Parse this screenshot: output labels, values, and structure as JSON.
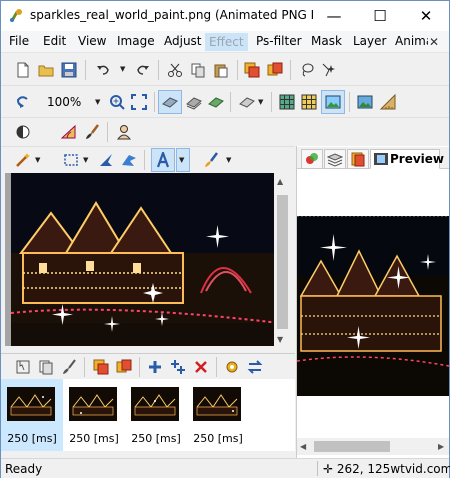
{
  "window": {
    "title": "sparkles_real_world_paint.png (Animated PNG Image, ...",
    "minimize_glyph": "—",
    "maximize_glyph": "☐",
    "close_glyph": "✕"
  },
  "menu": {
    "items": [
      "File",
      "Edit",
      "View",
      "Image",
      "Adjust",
      "Effect",
      "Ps-filter",
      "Mask",
      "Layer",
      "Anima"
    ],
    "active_index": 5,
    "close_glyph": "✕"
  },
  "toolbar": {
    "zoom_value": "100%"
  },
  "preview_panel": {
    "tab_label": "Preview"
  },
  "frames": [
    {
      "delay": "250 [ms]"
    },
    {
      "delay": "250 [ms]"
    },
    {
      "delay": "250 [ms]"
    },
    {
      "delay": "250 [ms]"
    }
  ],
  "status": {
    "left": "Ready",
    "coords": "262, 125",
    "watermark": "wtvid.com"
  },
  "icons": {
    "app": "paint-splash-icon",
    "new": "new-file-icon",
    "open": "open-folder-icon",
    "save": "save-disk-icon",
    "undo": "undo-icon",
    "redo": "redo-icon"
  },
  "colors": {
    "accent_blue": "#3b78c4",
    "menu_highlight": "#cce4f7",
    "frame_selected": "#cce8ff",
    "night_sky": "#1a1008"
  }
}
